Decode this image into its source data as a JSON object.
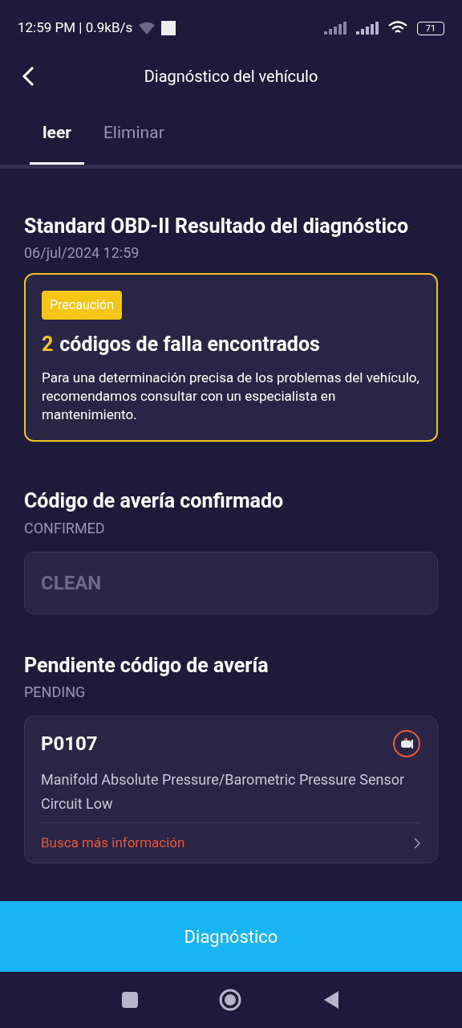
{
  "status_bar": {
    "time": "12:59 PM | 0.9kB/s",
    "battery": "71"
  },
  "header": {
    "title": "Diagnóstico del vehículo"
  },
  "tabs": [
    {
      "label": "leer",
      "selected": true
    },
    {
      "label": "Eliminar",
      "selected": false
    }
  ],
  "result": {
    "title": "Standard OBD-II Resultado del diagnóstico",
    "date": "06/jul/2024 12:59"
  },
  "alert": {
    "badge": "Precaución",
    "count": "2",
    "headline": "códigos de falla encontrados",
    "message": "Para una determinación precisa de los problemas del vehículo, recomendamos consultar con un especialista en mantenimiento."
  },
  "sections": [
    {
      "title": "Código de avería confirmado",
      "subtitle": "CONFIRMED",
      "kind": "empty",
      "empty_text": "CLEAN"
    },
    {
      "title": "Pendiente código de avería",
      "subtitle": "PENDING",
      "kind": "codes",
      "codes": [
        {
          "code": "P0107",
          "description": "Manifold Absolute Pressure/Barometric Pressure Sensor Circuit Low",
          "link": "Busca más información"
        }
      ]
    }
  ],
  "primary_button": "Diagnóstico"
}
